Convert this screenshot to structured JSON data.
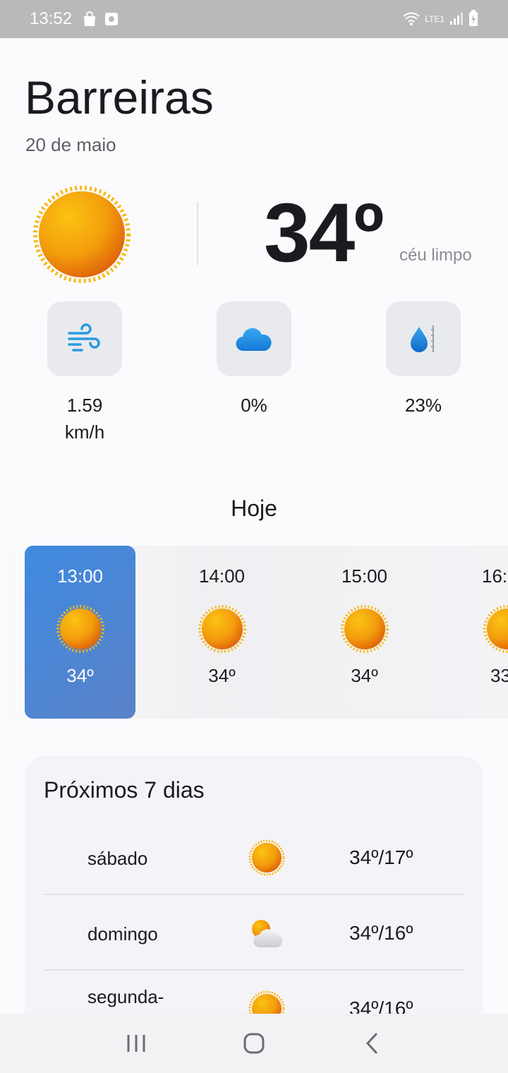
{
  "status": {
    "time": "13:52",
    "network": "LTE1"
  },
  "header": {
    "city": "Barreiras",
    "date": "20 de maio"
  },
  "current": {
    "temperature": "34º",
    "condition": "céu limpo",
    "icon": "sun-icon"
  },
  "metrics": [
    {
      "name": "wind",
      "icon": "wind-icon",
      "value": "1.59 km/h"
    },
    {
      "name": "clouds",
      "icon": "cloud-icon",
      "value": "0%"
    },
    {
      "name": "humidity",
      "icon": "humidity-icon",
      "value": "23%"
    }
  ],
  "today": {
    "title": "Hoje",
    "hours": [
      {
        "time": "13:00",
        "temp": "34º",
        "icon": "sun-icon",
        "active": true
      },
      {
        "time": "14:00",
        "temp": "34º",
        "icon": "sun-icon"
      },
      {
        "time": "15:00",
        "temp": "34º",
        "icon": "sun-icon"
      },
      {
        "time": "16:",
        "temp": "33",
        "icon": "sun-icon"
      }
    ]
  },
  "week": {
    "title": "Próximos 7 dias",
    "days": [
      {
        "day": "sábado",
        "temps": "34º/17º",
        "icon": "sun-icon"
      },
      {
        "day": "domingo",
        "temps": "34º/16º",
        "icon": "sun-cloud-icon"
      },
      {
        "day": "segunda-",
        "temps": "34º/16º",
        "icon": "sun-icon"
      }
    ]
  },
  "colors": {
    "accent": "#4a88d8",
    "sun_light": "#fbbf0f",
    "sun_dark": "#e06a0a"
  }
}
